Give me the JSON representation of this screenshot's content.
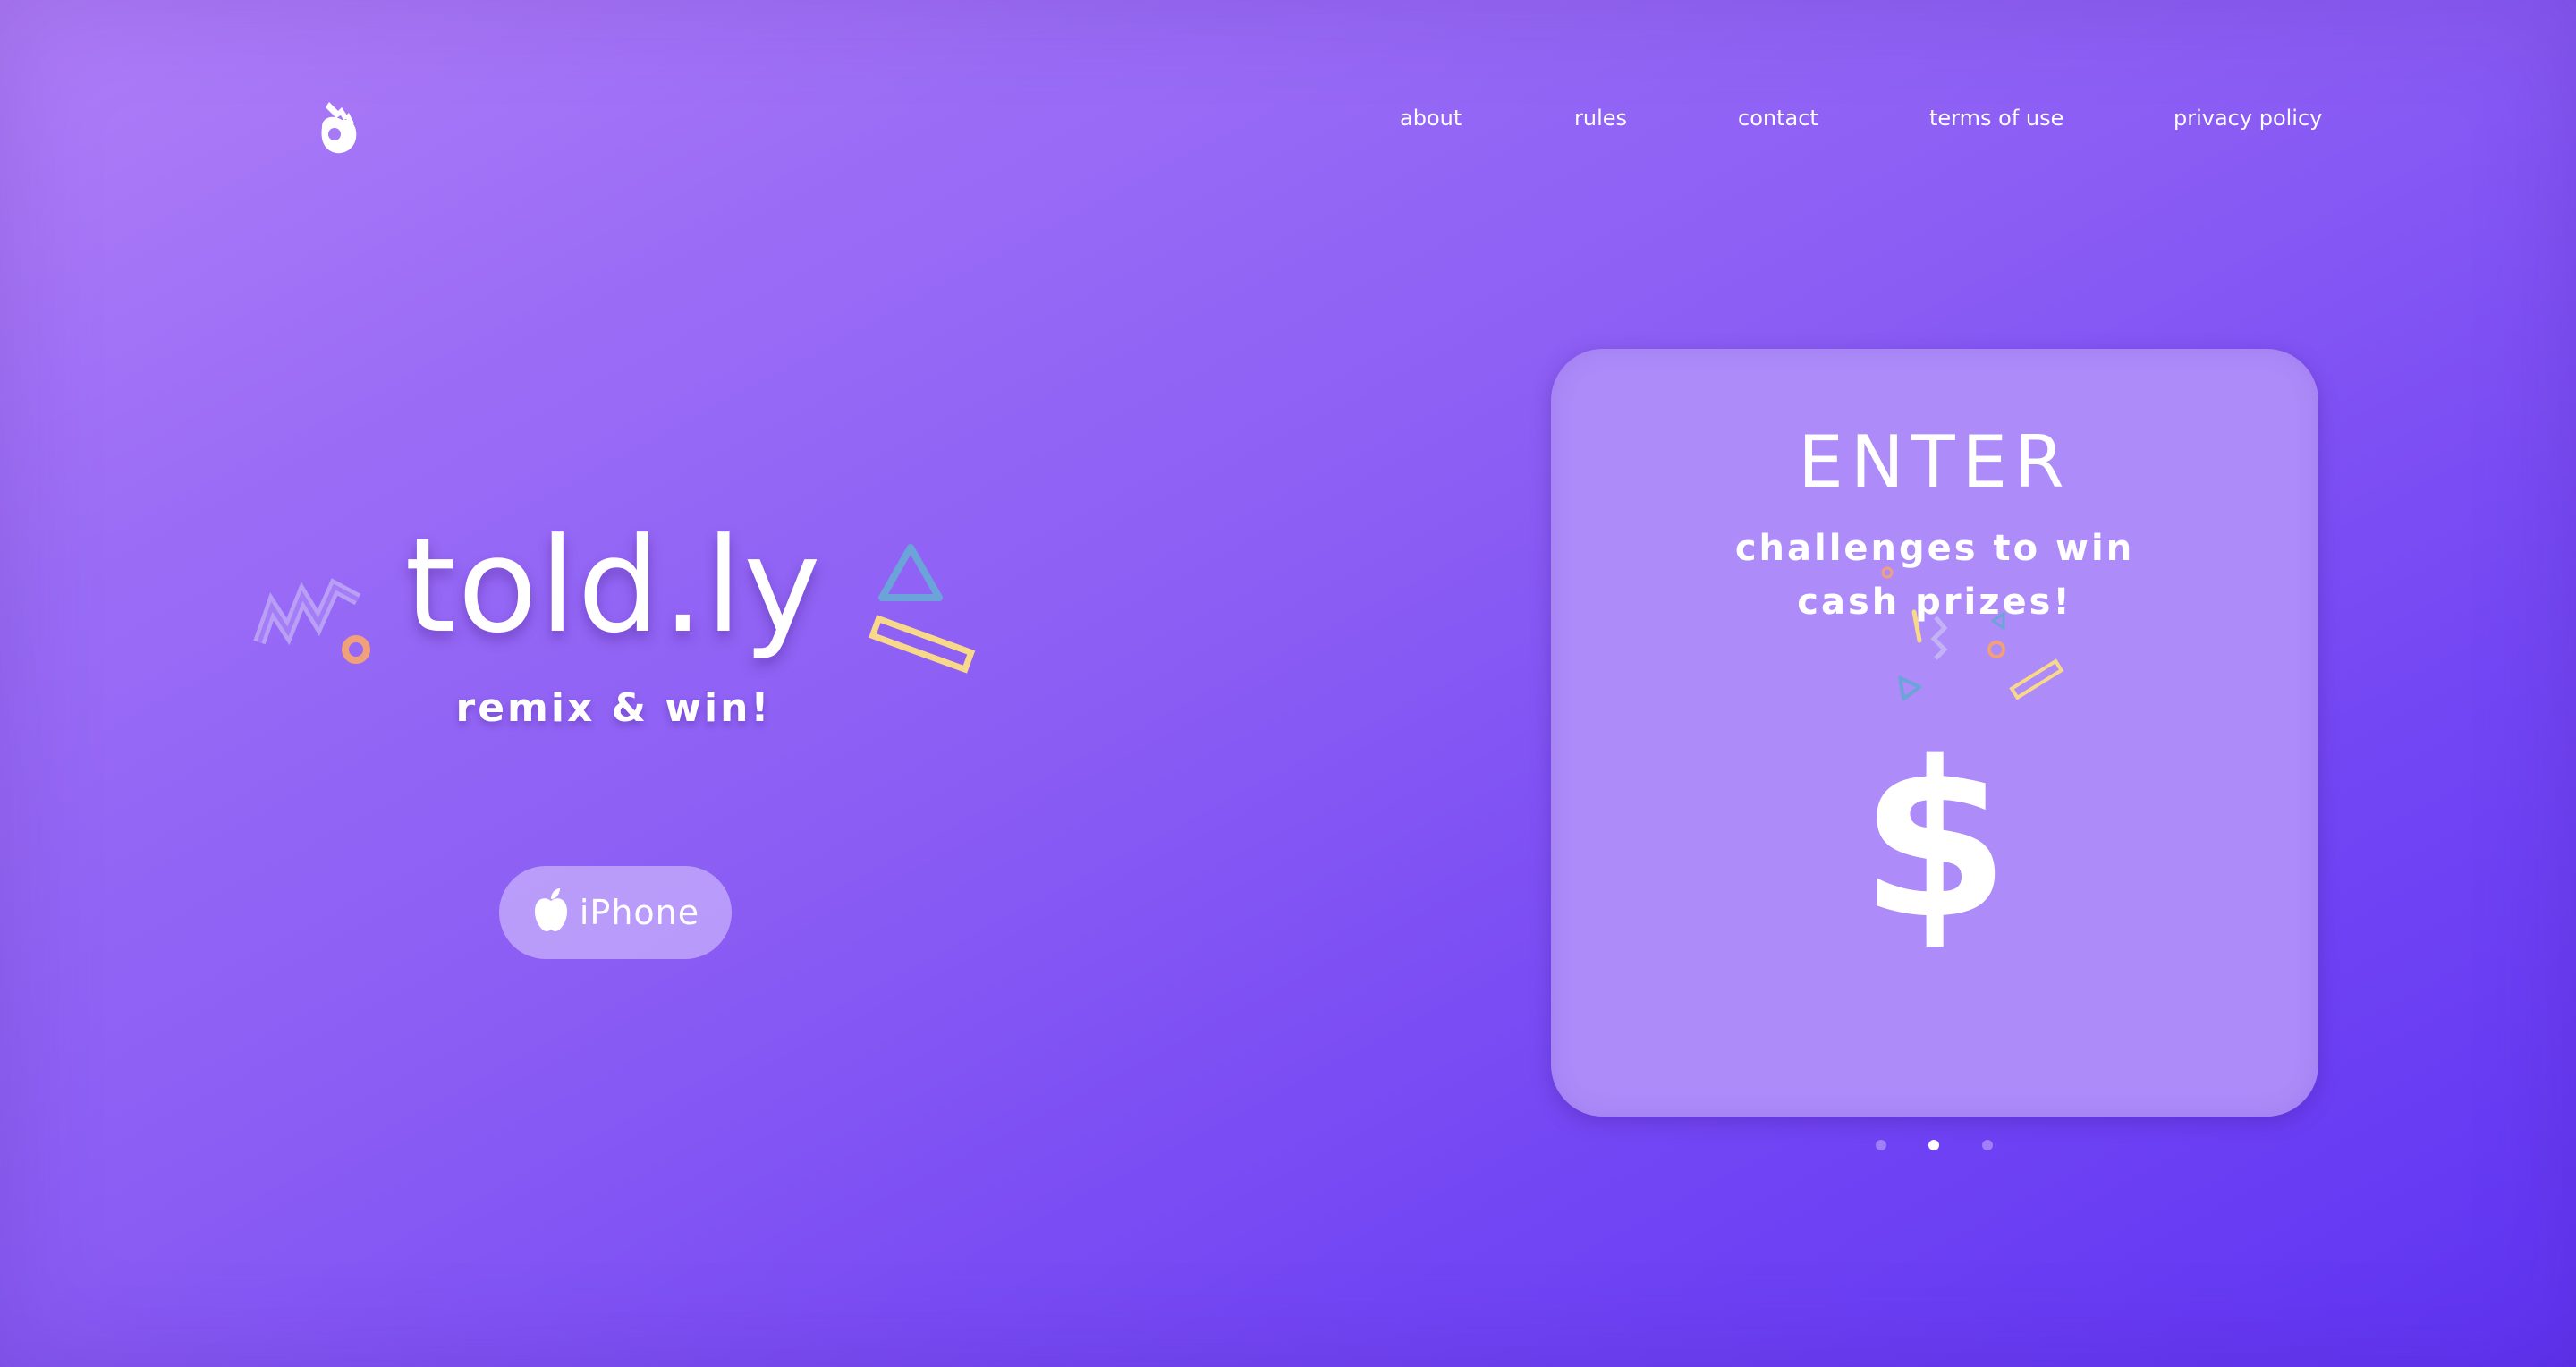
{
  "header": {
    "logo_icon": "ok-hand-icon",
    "nav": [
      {
        "label": "about"
      },
      {
        "label": "rules"
      },
      {
        "label": "contact"
      },
      {
        "label": "terms of use"
      },
      {
        "label": "privacy policy"
      }
    ]
  },
  "hero": {
    "brand": "told.ly",
    "tagline": "remix & win!",
    "download_button": {
      "icon": "apple-icon",
      "label": "iPhone"
    }
  },
  "carousel": {
    "card": {
      "title": "ENTER",
      "subtitle_line1": "challenges to win",
      "subtitle_line2": "cash prizes!",
      "symbol": "$"
    },
    "slide_count": 3,
    "active_slide": 2
  },
  "colors": {
    "background_start": "#b07ef8",
    "background_end": "#5f34f2",
    "card": "#ad8bf8",
    "deco_orange": "#f0a07a",
    "deco_yellow": "#f8d98a",
    "deco_blue": "#6aa4d8",
    "deco_lavender": "#c4b2f6"
  }
}
